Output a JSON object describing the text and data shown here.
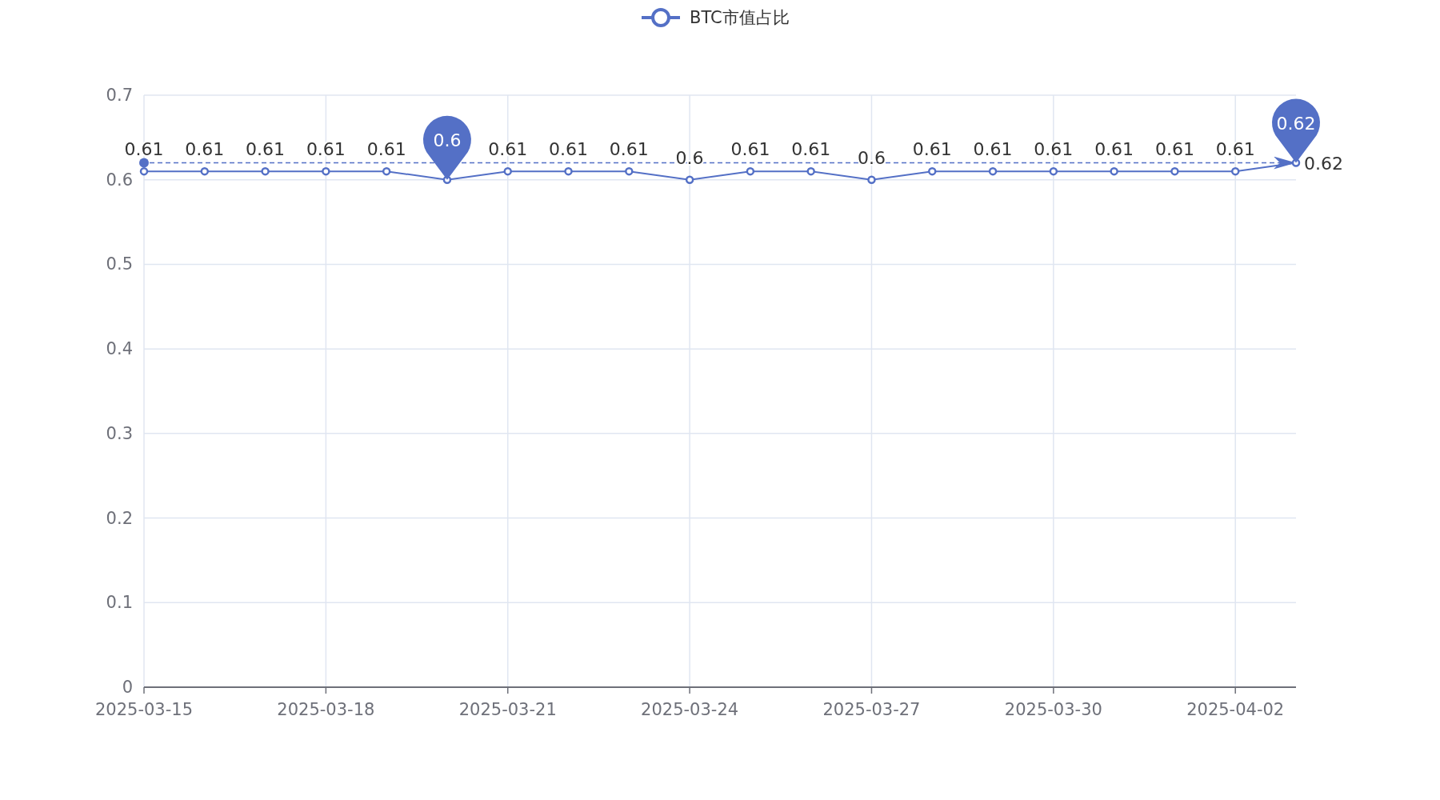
{
  "chart_data": {
    "type": "line",
    "categories": [
      "2025-03-15",
      null,
      null,
      "2025-03-18",
      null,
      null,
      "2025-03-21",
      null,
      null,
      "2025-03-24",
      null,
      null,
      "2025-03-27",
      null,
      null,
      "2025-03-30",
      null,
      null,
      "2025-04-02",
      null
    ],
    "series": [
      {
        "name": "BTC市值占比",
        "color": "#5470c6",
        "marker": "circle",
        "values": [
          0.61,
          0.61,
          0.61,
          0.61,
          0.61,
          0.6,
          0.61,
          0.61,
          0.61,
          0.6,
          0.61,
          0.61,
          0.6,
          0.61,
          0.61,
          0.61,
          0.61,
          0.61,
          0.61,
          0.62
        ]
      }
    ],
    "value_labels": [
      "0.61",
      "0.61",
      "0.61",
      "0.61",
      "0.61",
      null,
      "0.61",
      "0.61",
      "0.61",
      "0.6",
      "0.61",
      "0.61",
      "0.6",
      "0.61",
      "0.61",
      "0.61",
      "0.61",
      "0.61",
      "0.61",
      null
    ],
    "ylim": [
      0,
      0.7
    ],
    "yticks": [
      0,
      0.1,
      0.2,
      0.3,
      0.4,
      0.5,
      0.6,
      0.7
    ],
    "grid": true,
    "ref_lines": [
      {
        "axis": "y",
        "value": 0.62,
        "label": "0.62"
      }
    ],
    "annotations": [
      {
        "text": "0.6",
        "y": 0.6
      },
      {
        "text": "0.62",
        "y": 0.62
      }
    ]
  }
}
